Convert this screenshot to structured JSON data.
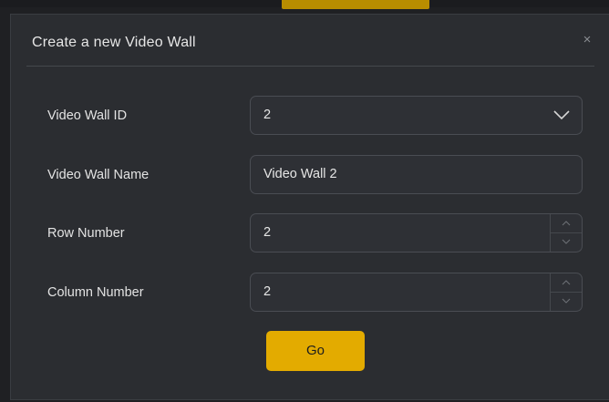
{
  "dialog": {
    "title": "Create a new Video Wall",
    "close_symbol": "×"
  },
  "form": {
    "video_wall_id": {
      "label": "Video Wall ID",
      "value": "2"
    },
    "video_wall_name": {
      "label": "Video Wall Name",
      "value": "Video Wall 2"
    },
    "row_number": {
      "label": "Row Number",
      "value": "2"
    },
    "column_number": {
      "label": "Column Number",
      "value": "2"
    }
  },
  "actions": {
    "go_label": "Go"
  },
  "colors": {
    "accent": "#e3ab00",
    "background": "#1f2023",
    "dialog_bg": "#2b2d31",
    "field_border": "#4a4d53",
    "text": "#e6e6e6"
  },
  "icons": {
    "close": "close-icon",
    "dropdown": "chevron-down-icon",
    "stepper_up": "chevron-up-icon",
    "stepper_down": "chevron-down-icon"
  }
}
